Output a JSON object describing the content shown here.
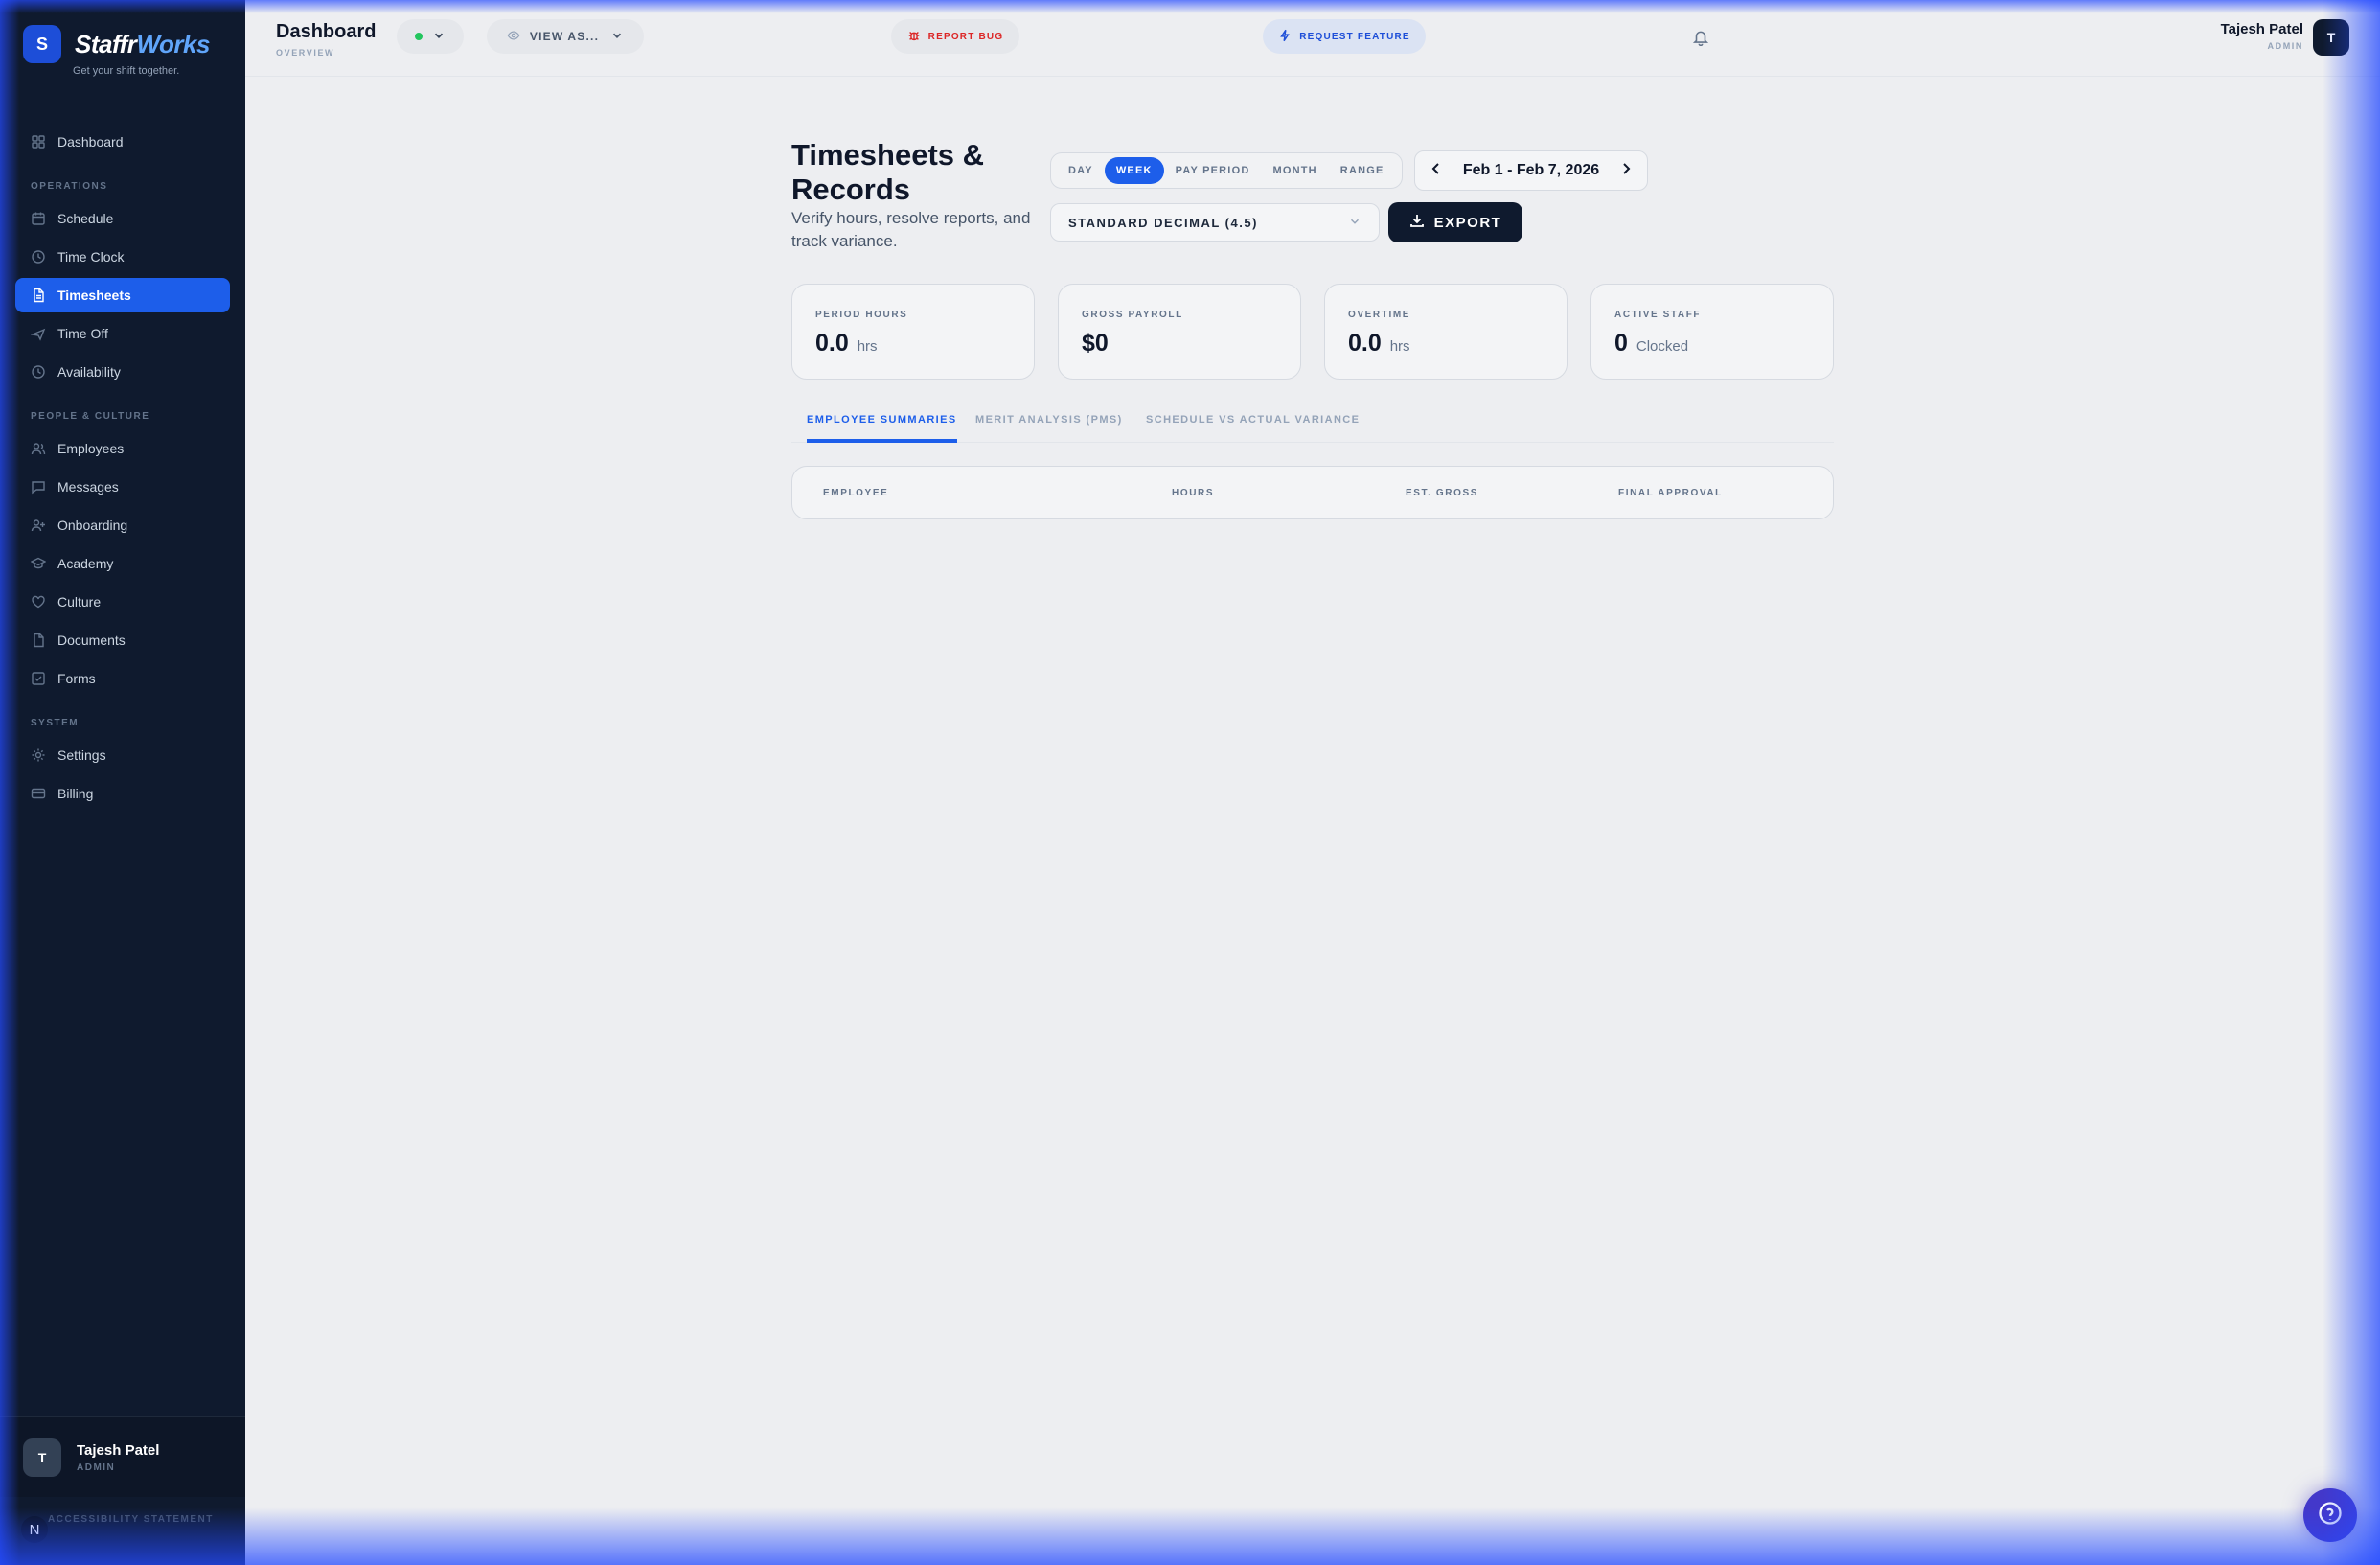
{
  "brand": {
    "initial": "S",
    "name_part1": "Staffr",
    "name_part2": "Works",
    "tagline": "Get your shift together."
  },
  "sidebar": {
    "top_items": [
      {
        "label": "Dashboard",
        "icon": "grid-icon"
      }
    ],
    "sections": [
      {
        "title": "OPERATIONS",
        "items": [
          {
            "label": "Schedule",
            "icon": "calendar-icon"
          },
          {
            "label": "Time Clock",
            "icon": "clock-icon"
          },
          {
            "label": "Timesheets",
            "icon": "file-icon",
            "active": true
          },
          {
            "label": "Time Off",
            "icon": "plane-icon"
          },
          {
            "label": "Availability",
            "icon": "clock-icon"
          }
        ]
      },
      {
        "title": "PEOPLE & CULTURE",
        "items": [
          {
            "label": "Employees",
            "icon": "users-icon"
          },
          {
            "label": "Messages",
            "icon": "message-icon"
          },
          {
            "label": "Onboarding",
            "icon": "user-plus-icon"
          },
          {
            "label": "Academy",
            "icon": "graduation-cap-icon"
          },
          {
            "label": "Culture",
            "icon": "heart-icon"
          },
          {
            "label": "Documents",
            "icon": "document-icon"
          },
          {
            "label": "Forms",
            "icon": "checkbox-icon"
          }
        ]
      },
      {
        "title": "SYSTEM",
        "items": [
          {
            "label": "Settings",
            "icon": "gear-icon"
          },
          {
            "label": "Billing",
            "icon": "card-icon"
          }
        ]
      }
    ],
    "user": {
      "initial": "T",
      "name": "Tajesh Patel",
      "role": "ADMIN"
    },
    "accessibility": "ACCESSIBILITY STATEMENT",
    "n_badge": "N"
  },
  "topbar": {
    "title": "Dashboard",
    "subtitle": "OVERVIEW",
    "view_as": "VIEW AS...",
    "report_bug": "REPORT BUG",
    "request_feature": "REQUEST FEATURE",
    "user_name": "Tajesh Patel",
    "user_role": "ADMIN",
    "user_initial": "T"
  },
  "page": {
    "title": "Timesheets & Records",
    "description": "Verify hours, resolve reports, and track variance.",
    "periods": [
      "DAY",
      "WEEK",
      "PAY PERIOD",
      "MONTH",
      "RANGE"
    ],
    "active_period": "WEEK",
    "date_range": "Feb 1 - Feb 7, 2026",
    "format": "STANDARD DECIMAL (4.5)",
    "export_label": "EXPORT"
  },
  "stats": [
    {
      "label": "PERIOD HOURS",
      "value": "0.0",
      "unit": "hrs"
    },
    {
      "label": "GROSS PAYROLL",
      "value": "$0",
      "unit": ""
    },
    {
      "label": "OVERTIME",
      "value": "0.0",
      "unit": "hrs"
    },
    {
      "label": "ACTIVE STAFF",
      "value": "0",
      "unit": "Clocked"
    }
  ],
  "tabs": [
    "EMPLOYEE SUMMARIES",
    "MERIT ANALYSIS (PMS)",
    "SCHEDULE VS ACTUAL VARIANCE"
  ],
  "table": {
    "headers": [
      "EMPLOYEE",
      "HOURS",
      "EST. GROSS",
      "FINAL APPROVAL"
    ]
  },
  "colors": {
    "accent": "#1d5eea",
    "sidebar_bg": "#0f1a2e",
    "danger": "#dc2626",
    "success": "#22c55e"
  }
}
